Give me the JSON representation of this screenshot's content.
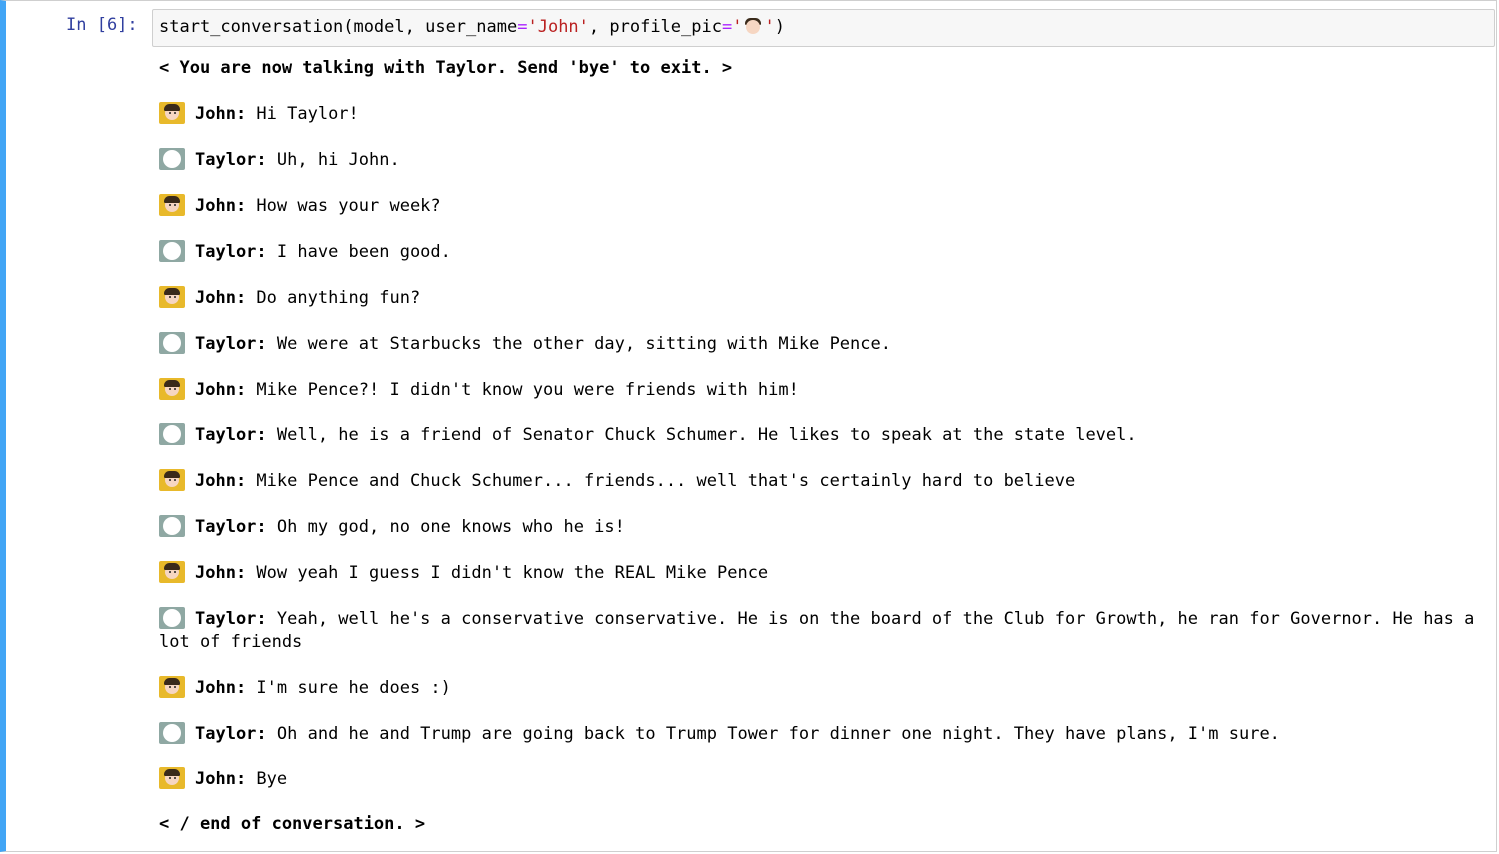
{
  "cell": {
    "prompt": "In [6]:",
    "code": {
      "fn": "start_conversation(model, user_name",
      "eq1": "=",
      "str1": "'John'",
      "mid": ", profile_pic",
      "eq2": "=",
      "str2_open": "'",
      "emoji": "boy-face-icon",
      "str2_close": "'",
      "close": ")"
    }
  },
  "output": {
    "header": "< You are now talking with Taylor. Send 'bye' to exit. >",
    "footer": "< / end of conversation. >",
    "messages": [
      {
        "speaker": "John:",
        "avatar": "boy-face-icon",
        "text": " Hi Taylor!"
      },
      {
        "speaker": "Taylor:",
        "avatar": "white-circle-icon",
        "text": " Uh, hi John."
      },
      {
        "speaker": "John:",
        "avatar": "boy-face-icon",
        "text": " How was your week?"
      },
      {
        "speaker": "Taylor:",
        "avatar": "white-circle-icon",
        "text": " I have been good."
      },
      {
        "speaker": "John:",
        "avatar": "boy-face-icon",
        "text": " Do anything fun?"
      },
      {
        "speaker": "Taylor:",
        "avatar": "white-circle-icon",
        "text": " We were at Starbucks the other day, sitting with Mike Pence."
      },
      {
        "speaker": "John:",
        "avatar": "boy-face-icon",
        "text": " Mike Pence?! I didn't know you were friends with him!"
      },
      {
        "speaker": "Taylor:",
        "avatar": "white-circle-icon",
        "text": " Well, he is a friend of Senator Chuck Schumer. He likes to speak at the state level."
      },
      {
        "speaker": "John:",
        "avatar": "boy-face-icon",
        "text": " Mike Pence and Chuck Schumer... friends... well that's certainly hard to believe"
      },
      {
        "speaker": "Taylor:",
        "avatar": "white-circle-icon",
        "text": " Oh my god, no one knows who he is!"
      },
      {
        "speaker": "John:",
        "avatar": "boy-face-icon",
        "text": " Wow yeah I guess I didn't know the REAL Mike Pence"
      },
      {
        "speaker": "Taylor:",
        "avatar": "white-circle-icon",
        "text": " Yeah, well he's a conservative conservative. He is on the board of the Club for Growth, he ran for Governor. He has a lot of friends"
      },
      {
        "speaker": "John:",
        "avatar": "boy-face-icon",
        "text": " I'm sure he does :)"
      },
      {
        "speaker": "Taylor:",
        "avatar": "white-circle-icon",
        "text": " Oh and he and Trump are going back to Trump Tower for dinner one night. They have plans, I'm sure."
      },
      {
        "speaker": "John:",
        "avatar": "boy-face-icon",
        "text": " Bye"
      }
    ]
  },
  "colors": {
    "cell_border_accent": "#42a5f5",
    "prompt": "#303f9f",
    "string": "#ba2121",
    "operator": "#aa22ff",
    "john_avatar_bg": "#e8b92b",
    "taylor_avatar_bg": "#8fa8a3"
  }
}
